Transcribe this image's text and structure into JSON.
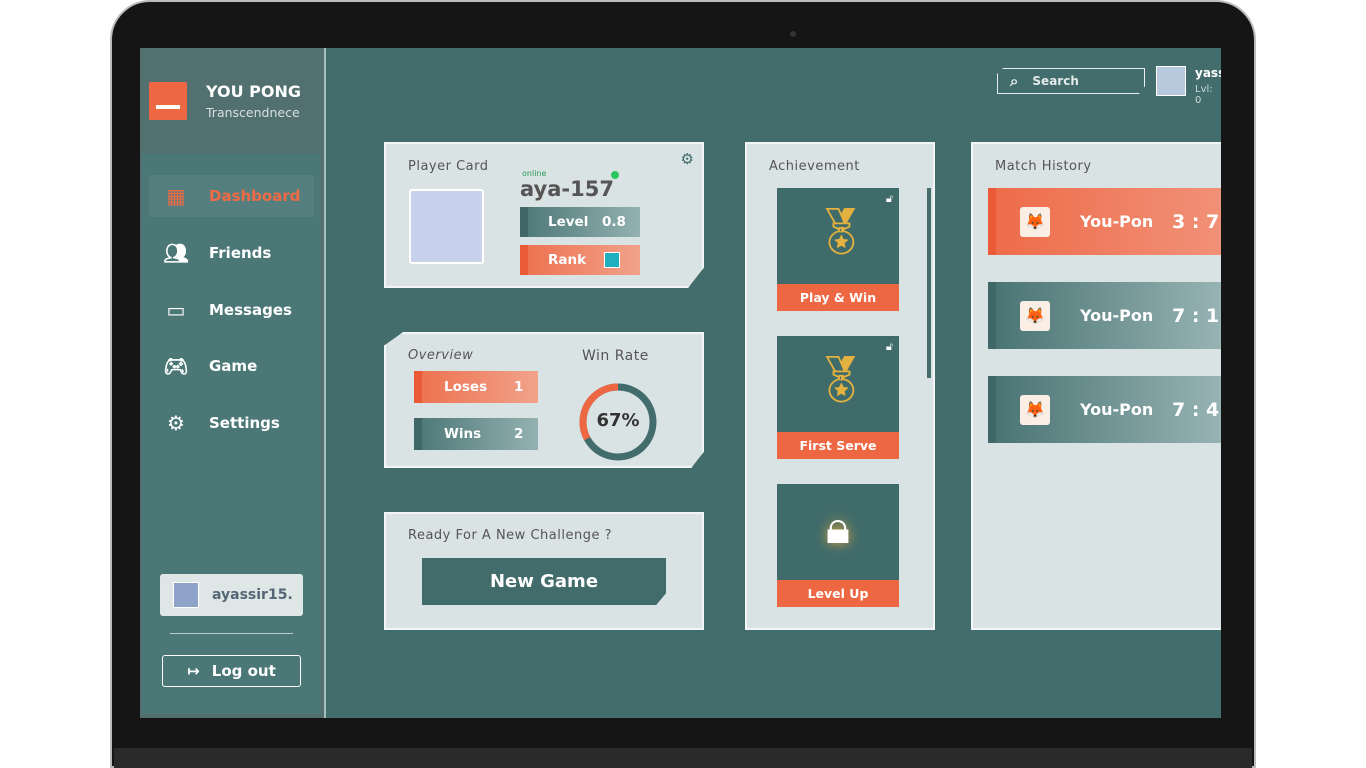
{
  "sidebar": {
    "brand": "YOU PONG",
    "subtitle": "Transcendnece",
    "items": [
      {
        "label": "Dashboard",
        "icon": "dashboard-icon",
        "active": true
      },
      {
        "label": "Friends",
        "icon": "users-icon"
      },
      {
        "label": "Messages",
        "icon": "message-icon"
      },
      {
        "label": "Game",
        "icon": "gamepad-icon"
      },
      {
        "label": "Settings",
        "icon": "gear-icon"
      }
    ],
    "username": "ayassir15.",
    "logout": "Log out"
  },
  "header": {
    "search_placeholder": "Search",
    "user_name": "yassi",
    "user_level": "Lvl: 0"
  },
  "player_card": {
    "title": "Player Card",
    "status": "online",
    "username": "aya-157",
    "level_label": "Level",
    "level_value": "0.8",
    "rank_label": "Rank"
  },
  "overview": {
    "title": "Overview",
    "loses_label": "Loses",
    "loses": "1",
    "wins_label": "Wins",
    "wins": "2",
    "winrate_title": "Win Rate",
    "winrate": "67%",
    "winrate_value": 67
  },
  "challenge": {
    "title": "Ready For A New Challenge ?",
    "button": "New Game"
  },
  "achievement": {
    "title": "Achievement",
    "items": [
      {
        "label": "Play & Win",
        "locked": false
      },
      {
        "label": "First Serve",
        "locked": false
      },
      {
        "label": "Level Up",
        "locked": true
      }
    ]
  },
  "match_history": {
    "title": "Match History",
    "items": [
      {
        "name": "You-Pon",
        "score": "3 : 7",
        "result": "loss"
      },
      {
        "name": "You-Pon",
        "score": "7 : 1",
        "result": "win"
      },
      {
        "name": "You-Pon",
        "score": "7 : 4",
        "result": "win"
      }
    ]
  },
  "colors": {
    "accent": "#ee6743",
    "teal": "#436c6c",
    "card": "#dae3e3"
  }
}
